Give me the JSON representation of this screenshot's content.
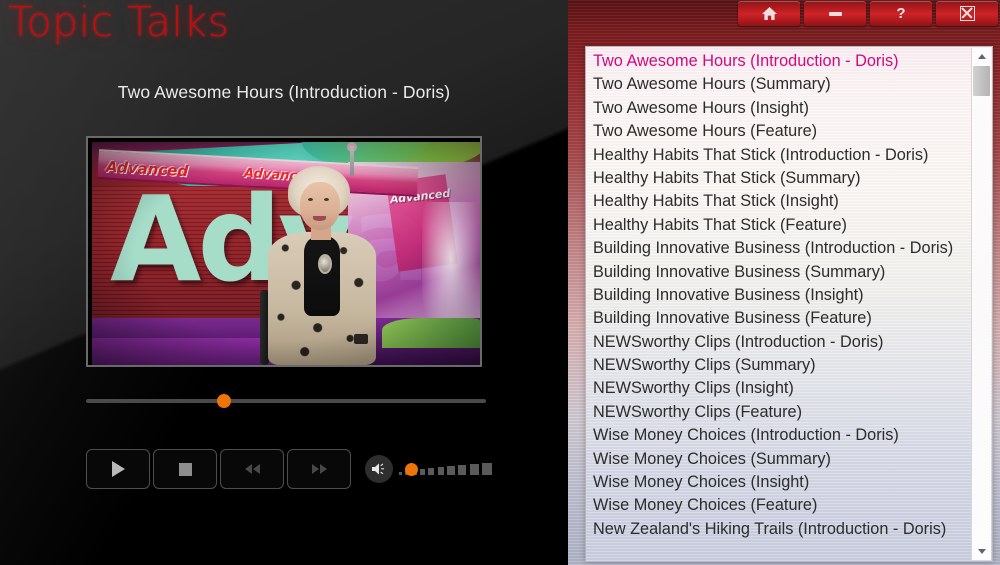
{
  "brand": {
    "title": "Topic Talks"
  },
  "player": {
    "now_playing_title": "Two Awesome Hours (Introduction - Doris)",
    "progress_percent": 34,
    "volume_percent": 5,
    "controls": [
      {
        "name": "play",
        "label": "Play",
        "icon": "play-icon",
        "enabled": true
      },
      {
        "name": "stop",
        "label": "Stop",
        "icon": "stop-icon",
        "enabled": true
      },
      {
        "name": "rewind",
        "label": "Rewind",
        "icon": "rewind-icon",
        "enabled": false
      },
      {
        "name": "forward",
        "label": "Fast Forward",
        "icon": "fast-forward-icon",
        "enabled": false
      }
    ],
    "volume_icon": "speaker-icon",
    "volume_bar_count": 10
  },
  "titlebar": {
    "buttons": [
      {
        "name": "home",
        "label": "",
        "icon": "home-icon"
      },
      {
        "name": "minimize",
        "label": "",
        "icon": "minimize-icon"
      },
      {
        "name": "help",
        "label": "?",
        "icon": "help-icon"
      },
      {
        "name": "close",
        "label": "",
        "icon": "close-icon"
      }
    ]
  },
  "playlist": {
    "selected_index": 0,
    "scroll": {
      "up_icon": "chevron-up-icon",
      "down_icon": "chevron-down-icon"
    },
    "items": [
      "Two Awesome Hours (Introduction - Doris)",
      "Two Awesome Hours (Summary)",
      "Two Awesome Hours (Insight)",
      "Two Awesome Hours (Feature)",
      "Healthy Habits That Stick (Introduction - Doris)",
      "Healthy Habits That Stick (Summary)",
      "Healthy Habits That Stick (Insight)",
      "Healthy Habits That Stick (Feature)",
      "Building Innovative Business (Introduction - Doris)",
      "Building Innovative Business (Summary)",
      "Building Innovative Business (Insight)",
      "Building Innovative Business (Feature)",
      "NEWSworthy Clips (Introduction - Doris)",
      "NEWSworthy Clips (Summary)",
      "NEWSworthy Clips (Insight)",
      "NEWSworthy Clips (Feature)",
      "Wise Money Choices (Introduction - Doris)",
      "Wise Money Choices (Summary)",
      "Wise Money Choices (Insight)",
      "Wise Money Choices (Feature)",
      "New Zealand's Hiking Trails (Introduction - Doris)"
    ]
  },
  "video_scene": {
    "set_text_large": "Adva",
    "banner_text_1": "Advanced",
    "banner_text_2": "Advanced",
    "panel_text": "Advanced"
  },
  "colors": {
    "brand_red": "#c00d10",
    "accent_orange": "#ef7407",
    "selected_item": "#d1097f",
    "panel_red": "#90262a"
  }
}
